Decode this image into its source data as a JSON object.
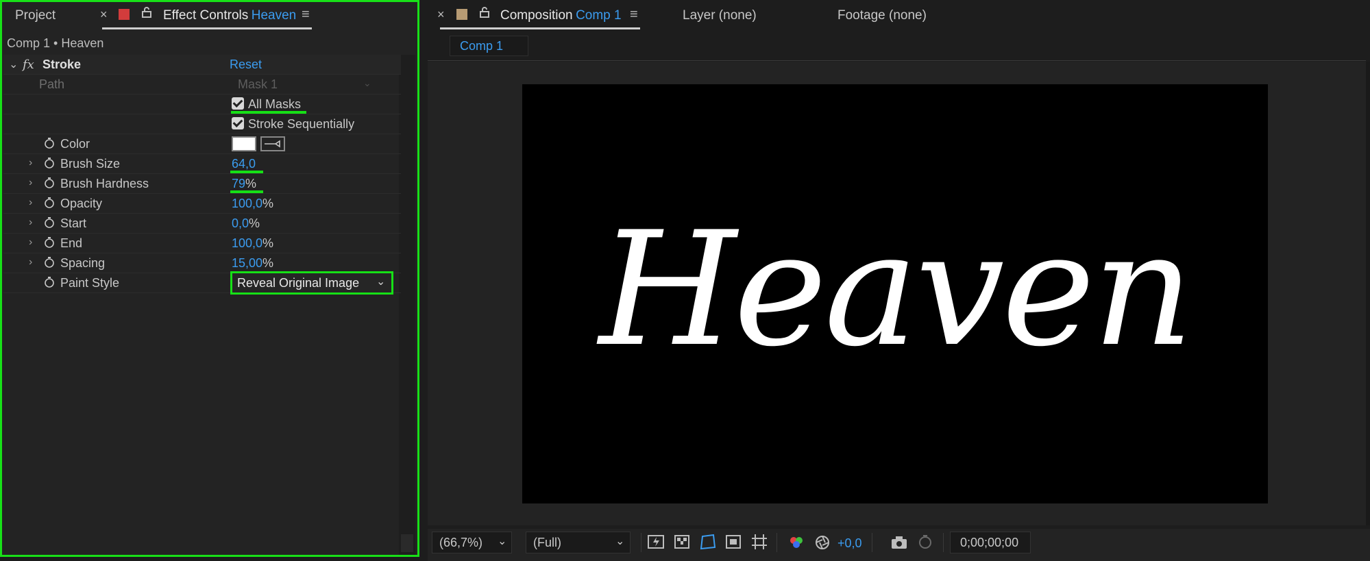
{
  "left_panel": {
    "tabs": {
      "project": "Project",
      "effect_controls_prefix": "Effect Controls",
      "effect_controls_layer": "Heaven"
    },
    "breadcrumb": "Comp 1 • Heaven",
    "effect": {
      "fx_label": "fx",
      "name": "Stroke",
      "reset": "Reset"
    },
    "properties": {
      "path_label": "Path",
      "path_value": "Mask 1",
      "all_masks_label": "All Masks",
      "stroke_sequentially_label": "Stroke Sequentially",
      "color_label": "Color",
      "color_value": "#ffffff",
      "brush_size_label": "Brush Size",
      "brush_size_value": "64,0",
      "brush_hardness_label": "Brush Hardness",
      "brush_hardness_value": "79",
      "opacity_label": "Opacity",
      "opacity_value": "100,0",
      "start_label": "Start",
      "start_value": "0,0",
      "end_label": "End",
      "end_value": "100,0",
      "spacing_label": "Spacing",
      "spacing_value": "15,00",
      "paint_style_label": "Paint Style",
      "paint_style_value": "Reveal Original Image",
      "percent": "%"
    }
  },
  "right_panel": {
    "tabs": {
      "composition_prefix": "Composition",
      "composition_name": "Comp 1",
      "layer": "Layer (none)",
      "footage": "Footage (none)"
    },
    "viewer_tab": "Comp 1",
    "composition_text": "Heaven",
    "bottom_bar": {
      "zoom": "(66,7%)",
      "resolution": "(Full)",
      "exposure": "+0,0",
      "timecode": "0;00;00;00"
    }
  },
  "colors": {
    "highlight_green": "#16e016",
    "accent_blue": "#3b9cf0",
    "label_red": "#d23c3c",
    "label_tan": "#b79b74"
  }
}
